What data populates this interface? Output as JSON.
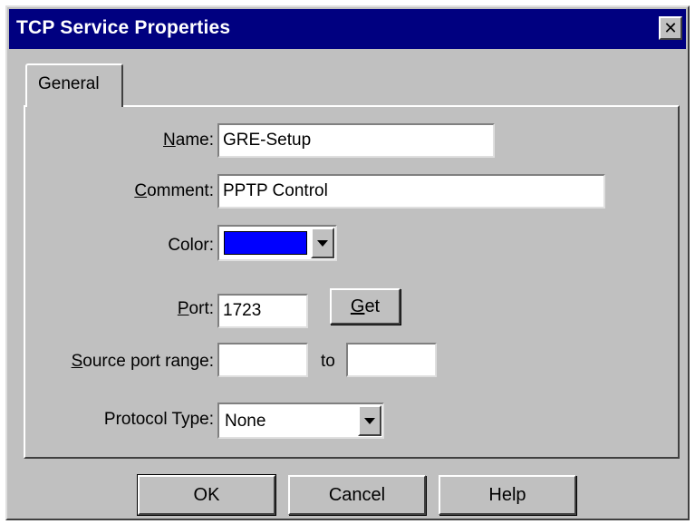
{
  "window": {
    "title": "TCP Service Properties",
    "close_label": "✕"
  },
  "tabs": [
    {
      "label": "General"
    }
  ],
  "form": {
    "name": {
      "label_prefix": "",
      "label_mnemonic": "N",
      "label_suffix": "ame:",
      "value": "GRE-Setup"
    },
    "comment": {
      "label_prefix": "",
      "label_mnemonic": "C",
      "label_suffix": "omment:",
      "value": "PPTP Control"
    },
    "color": {
      "label": "Color:",
      "value": "#0000ff"
    },
    "port": {
      "label_prefix": "",
      "label_mnemonic": "P",
      "label_suffix": "ort:",
      "value": "1723",
      "get_prefix": "",
      "get_mnemonic": "G",
      "get_suffix": "et"
    },
    "source_port_range": {
      "label_prefix": "",
      "label_mnemonic": "S",
      "label_suffix": "ource port range:",
      "from": "",
      "to_label": "to",
      "to": ""
    },
    "protocol_type": {
      "label": "Protocol Type:",
      "value": "None"
    }
  },
  "buttons": {
    "ok": "OK",
    "cancel": "Cancel",
    "help": "Help"
  },
  "icons": {
    "close": "close-icon",
    "dropdown": "chevron-down-icon"
  }
}
